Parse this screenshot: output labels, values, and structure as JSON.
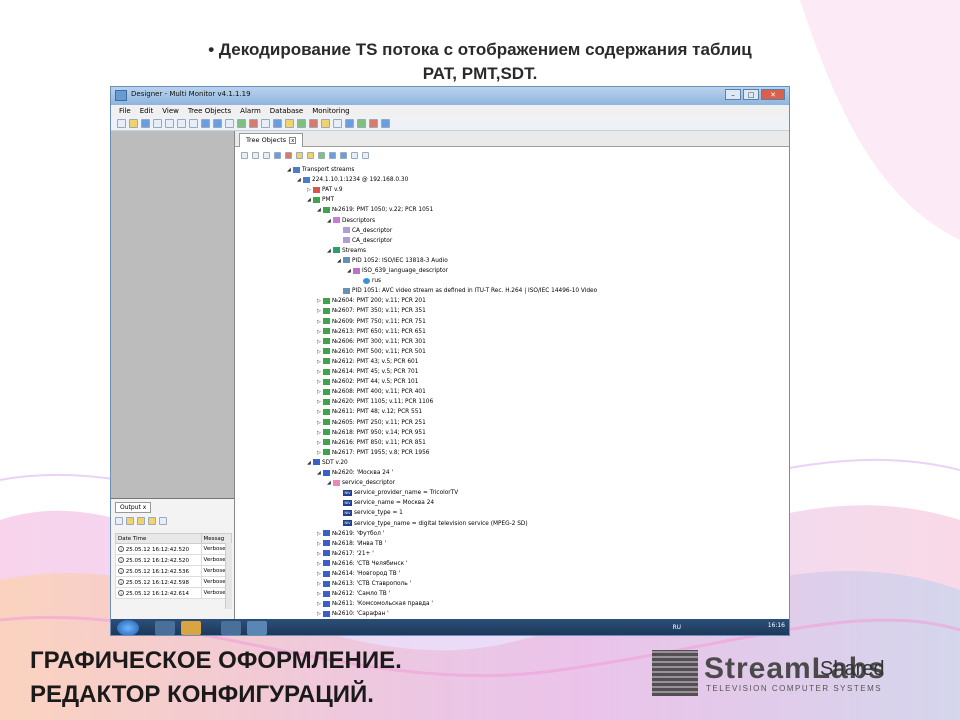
{
  "slide": {
    "title_line1": "• Декодирование TS потока с отображением содержания таблиц",
    "title_line2": "PAT, PMT,SDT.",
    "footer_line1": "ГРАФИЧЕСКОЕ ОФОРМЛЕНИЕ.",
    "footer_line2": "РЕДАКТОР КОНФИГУРАЦИЙ.",
    "logo_text": "StreamLabs",
    "logo_sub": "TELEVISION COMPUTER SYSTEMS",
    "logo_overlay": "Shared"
  },
  "window": {
    "title": "Designer - Multi Monitor v4.1.1.19",
    "controls": [
      "–",
      "□",
      "✕"
    ]
  },
  "menu": [
    "File",
    "Edit",
    "View",
    "Tree Objects",
    "Alarm",
    "Database",
    "Monitoring"
  ],
  "tree_tab": "Tree Objects",
  "tree": [
    {
      "label": "Transport streams",
      "depth": 0,
      "icon": "ts",
      "exp": "◢"
    },
    {
      "label": "224.1.10.1:1234 @ 192.168.0.30",
      "depth": 1,
      "icon": "ts",
      "exp": "◢"
    },
    {
      "label": "PAT v.9",
      "depth": 2,
      "icon": "pat",
      "exp": "▷"
    },
    {
      "label": "PMT",
      "depth": 2,
      "icon": "pmt",
      "exp": "◢"
    },
    {
      "label": "№2619: PMT 1050; v.22; PCR 1051",
      "depth": 3,
      "icon": "pmt",
      "exp": "◢"
    },
    {
      "label": "Descriptors",
      "depth": 4,
      "icon": "desc",
      "exp": "◢"
    },
    {
      "label": "CA_descriptor",
      "depth": 5,
      "icon": "ca",
      "exp": ""
    },
    {
      "label": "CA_descriptor",
      "depth": 5,
      "icon": "ca",
      "exp": ""
    },
    {
      "label": "Streams",
      "depth": 4,
      "icon": "str",
      "exp": "◢"
    },
    {
      "label": "PID 1052: ISO/IEC 13818-3 Audio",
      "depth": 5,
      "icon": "pid",
      "exp": "◢"
    },
    {
      "label": "ISO_639_language_descriptor",
      "depth": 6,
      "icon": "iso",
      "exp": "◢"
    },
    {
      "label": "rus",
      "depth": 7,
      "icon": "globe",
      "exp": ""
    },
    {
      "label": "PID 1051: AVC video stream as defined in ITU-T Rec. H.264 | ISO/IEC 14496-10 Video",
      "depth": 5,
      "icon": "pid",
      "exp": ""
    },
    {
      "label": "№2604: PMT 200; v.11; PCR 201",
      "depth": 3,
      "icon": "pmt",
      "exp": "▷"
    },
    {
      "label": "№2607: PMT 350; v.11; PCR 351",
      "depth": 3,
      "icon": "pmt",
      "exp": "▷"
    },
    {
      "label": "№2609: PMT 750; v.11; PCR 751",
      "depth": 3,
      "icon": "pmt",
      "exp": "▷"
    },
    {
      "label": "№2613: PMT 650; v.11; PCR 651",
      "depth": 3,
      "icon": "pmt",
      "exp": "▷"
    },
    {
      "label": "№2606: PMT 300; v.11; PCR 301",
      "depth": 3,
      "icon": "pmt",
      "exp": "▷"
    },
    {
      "label": "№2610: PMT 500; v.11; PCR 501",
      "depth": 3,
      "icon": "pmt",
      "exp": "▷"
    },
    {
      "label": "№2612: PMT 43; v.5; PCR 601",
      "depth": 3,
      "icon": "pmt",
      "exp": "▷"
    },
    {
      "label": "№2614: PMT 45; v.5; PCR 701",
      "depth": 3,
      "icon": "pmt",
      "exp": "▷"
    },
    {
      "label": "№2602: PMT 44; v.5; PCR 101",
      "depth": 3,
      "icon": "pmt",
      "exp": "▷"
    },
    {
      "label": "№2608: PMT 400; v.11; PCR 401",
      "depth": 3,
      "icon": "pmt",
      "exp": "▷"
    },
    {
      "label": "№2620: PMT 1105; v.11; PCR 1106",
      "depth": 3,
      "icon": "pmt",
      "exp": "▷"
    },
    {
      "label": "№2611: PMT 48; v.12; PCR 551",
      "depth": 3,
      "icon": "pmt",
      "exp": "▷"
    },
    {
      "label": "№2605: PMT 250; v.11; PCR 251",
      "depth": 3,
      "icon": "pmt",
      "exp": "▷"
    },
    {
      "label": "№2618: PMT 950; v.14; PCR 951",
      "depth": 3,
      "icon": "pmt",
      "exp": "▷"
    },
    {
      "label": "№2616: PMT 850; v.11; PCR 851",
      "depth": 3,
      "icon": "pmt",
      "exp": "▷"
    },
    {
      "label": "№2617: PMT 1955; v.8; PCR 1956",
      "depth": 3,
      "icon": "pmt",
      "exp": "▷"
    },
    {
      "label": "SDT v.20",
      "depth": 2,
      "icon": "sdt",
      "exp": "◢"
    },
    {
      "label": "№2620: 'Москва 24 '",
      "depth": 3,
      "icon": "srv",
      "exp": "◢"
    },
    {
      "label": "service_descriptor",
      "depth": 4,
      "icon": "sd",
      "exp": "◢"
    },
    {
      "label": "service_provider_name = TricolorTV",
      "depth": 5,
      "icon": "niv",
      "exp": ""
    },
    {
      "label": "service_name = Москва 24",
      "depth": 5,
      "icon": "niv",
      "exp": ""
    },
    {
      "label": "service_type = 1",
      "depth": 5,
      "icon": "niv",
      "exp": ""
    },
    {
      "label": "service_type_name = digital television service (MPEG-2 SD)",
      "depth": 5,
      "icon": "niv",
      "exp": ""
    },
    {
      "label": "№2619: 'Футбол '",
      "depth": 3,
      "icon": "srv",
      "exp": "▷"
    },
    {
      "label": "№2618: 'Инва ТВ '",
      "depth": 3,
      "icon": "srv",
      "exp": "▷"
    },
    {
      "label": "№2617: '21+ '",
      "depth": 3,
      "icon": "srv",
      "exp": "▷"
    },
    {
      "label": "№2616: 'СТВ Челябинск '",
      "depth": 3,
      "icon": "srv",
      "exp": "▷"
    },
    {
      "label": "№2614: 'Новгород ТВ '",
      "depth": 3,
      "icon": "srv",
      "exp": "▷"
    },
    {
      "label": "№2613: 'СТВ Ставрополь '",
      "depth": 3,
      "icon": "srv",
      "exp": "▷"
    },
    {
      "label": "№2612: 'Самло ТВ '",
      "depth": 3,
      "icon": "srv",
      "exp": "▷"
    },
    {
      "label": "№2611: 'Комсомольская правда '",
      "depth": 3,
      "icon": "srv",
      "exp": "▷"
    },
    {
      "label": "№2610: 'Сарафан '",
      "depth": 3,
      "icon": "srv",
      "exp": "▷"
    }
  ],
  "output": {
    "tab": "Output",
    "columns": [
      "Date Time",
      "Messag"
    ],
    "rows": [
      {
        "time": "25.05.12 16:12:42.520",
        "msg": "Verbose"
      },
      {
        "time": "25.05.12 16:12:42.520",
        "msg": "Verbose"
      },
      {
        "time": "25.05.12 16:12:42.536",
        "msg": "Verbose"
      },
      {
        "time": "25.05.12 16:12:42.598",
        "msg": "Verbose"
      },
      {
        "time": "25.05.12 16:12:42.614",
        "msg": "Verbose"
      }
    ]
  },
  "taskbar": {
    "lang": "RU",
    "time": "16:16"
  }
}
